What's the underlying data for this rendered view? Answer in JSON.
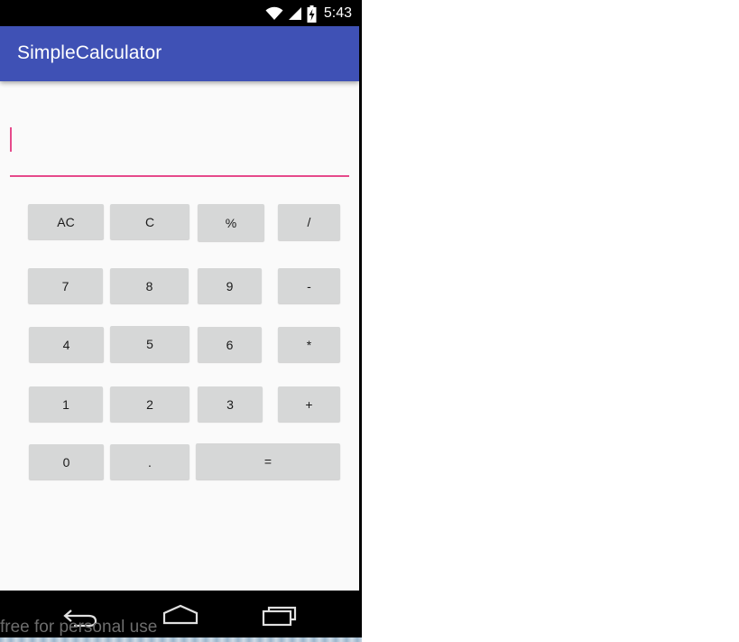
{
  "status_bar": {
    "time": "5:43",
    "icons": [
      "wifi-icon",
      "cellular-signal-icon",
      "battery-charging-icon"
    ]
  },
  "app_bar": {
    "title": "SimpleCalculator"
  },
  "display": {
    "value": "",
    "accent_color": "#e64a8b"
  },
  "keypad": {
    "rows": [
      [
        "AC",
        "C",
        "%",
        "/"
      ],
      [
        "7",
        "8",
        "9",
        "-"
      ],
      [
        "4",
        "5",
        "6",
        "*"
      ],
      [
        "1",
        "2",
        "3",
        "+"
      ],
      [
        "0",
        ".",
        "="
      ]
    ]
  },
  "nav_bar": {
    "icons": [
      "back-icon",
      "home-icon",
      "recents-icon"
    ]
  },
  "watermark": "free for personal use",
  "colors": {
    "primary": "#3f51b5",
    "background": "#fafafa",
    "key": "#d6d7d7"
  }
}
